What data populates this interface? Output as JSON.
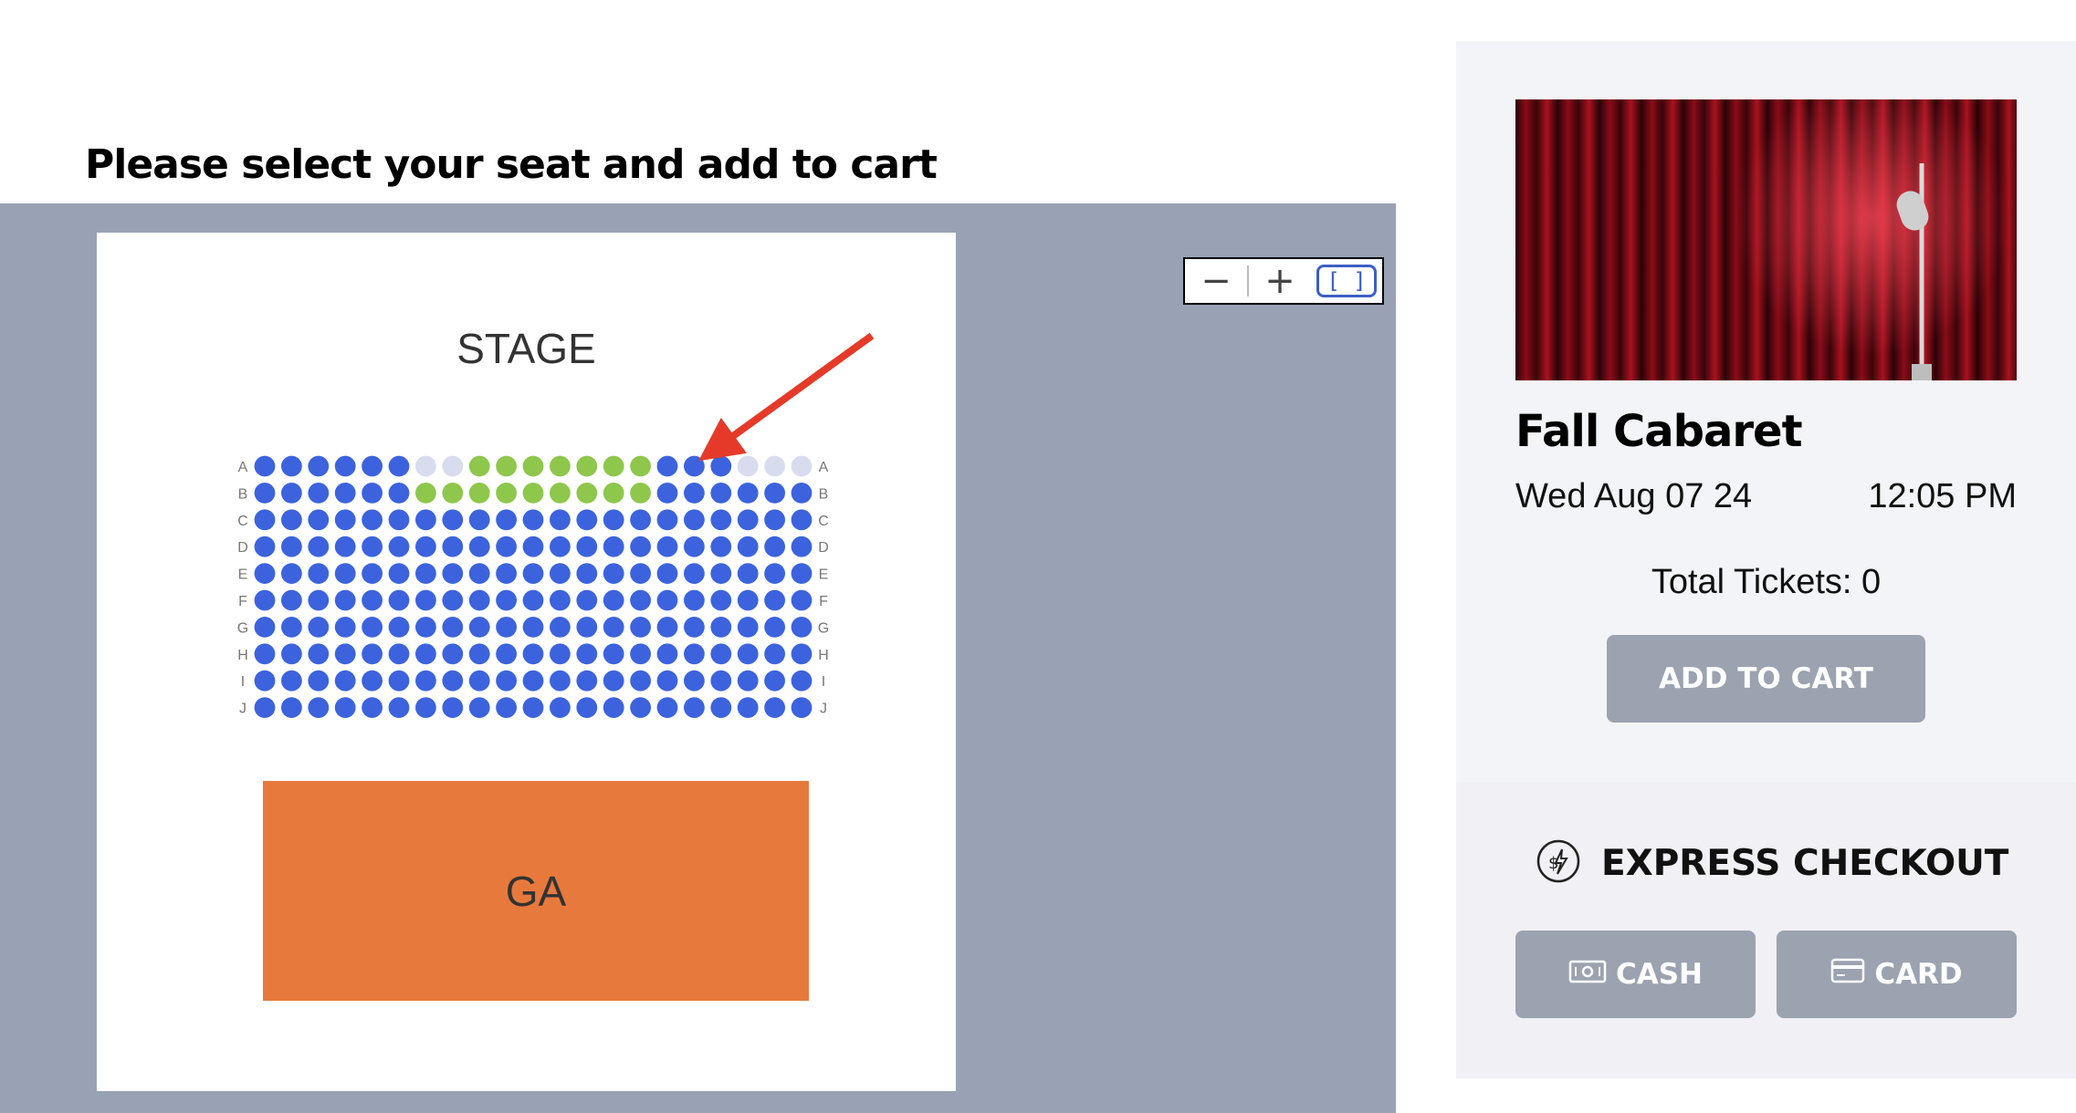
{
  "page": {
    "title": "Please select your seat and add to cart"
  },
  "seat_map": {
    "stage_label": "STAGE",
    "ga_label": "GA",
    "rows": [
      "A",
      "B",
      "C",
      "D",
      "E",
      "F",
      "G",
      "H",
      "I",
      "J"
    ],
    "seats_per_row": 21,
    "unavailable": {
      "A": [
        6,
        7,
        18,
        19,
        20
      ],
      "B": []
    },
    "selected": {
      "A": [
        8,
        9,
        10,
        11,
        12,
        13,
        14
      ],
      "B": [
        6,
        7,
        8,
        9,
        10,
        11,
        12,
        13,
        14
      ]
    },
    "colors": {
      "available": "#3c63dd",
      "selected": "#8ec74b",
      "unavailable": "#d8dcef",
      "ga": "#e8793c",
      "row_label": "#777777"
    },
    "zoom": {
      "zoom_out": "−",
      "zoom_in": "+",
      "fit": "[ ]"
    }
  },
  "annotation": {
    "arrow_color": "#e53a2a"
  },
  "event": {
    "title": "Fall Cabaret",
    "date": "Wed Aug 07 24",
    "time": "12:05 PM",
    "total_tickets": "Total Tickets: 0",
    "add_to_cart": "ADD TO CART"
  },
  "express": {
    "title": "EXPRESS CHECKOUT",
    "icon": "express-money-icon",
    "cash_label": "CASH",
    "card_label": "CARD"
  }
}
